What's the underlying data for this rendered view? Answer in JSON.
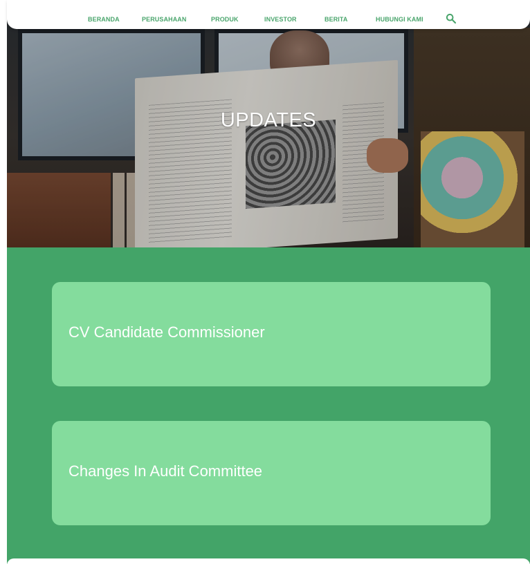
{
  "nav": {
    "items": [
      {
        "label": "BERANDA"
      },
      {
        "label": "PERUSAHAAN"
      },
      {
        "label": "PRODUK"
      },
      {
        "label": "INVESTOR"
      },
      {
        "label": "BERITA"
      },
      {
        "label": "HUBUNGI KAMI"
      }
    ],
    "search_icon": "search-icon"
  },
  "hero": {
    "title": "UPDATES"
  },
  "cards": [
    {
      "title": "CV Candidate Commissioner"
    },
    {
      "title": "Changes In Audit Committee"
    }
  ],
  "colors": {
    "page_green": "#43a468",
    "card_green": "#84dc9d",
    "nav_text": "#4aa56c"
  }
}
